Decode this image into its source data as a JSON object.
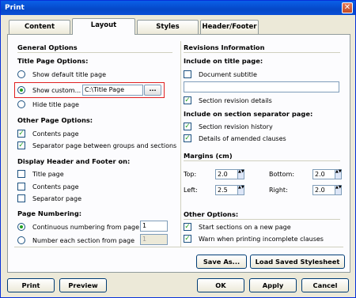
{
  "window": {
    "title": "Print",
    "close_glyph": "✕"
  },
  "tabs": [
    {
      "label": "Content",
      "active": false
    },
    {
      "label": "Layout",
      "active": true
    },
    {
      "label": "Styles",
      "active": false
    },
    {
      "label": "Header/Footer",
      "active": false
    }
  ],
  "general": {
    "heading": "General Options",
    "title_page_heading": "Title Page Options:",
    "show_default": "Show default title page",
    "show_custom": "Show custom...",
    "custom_path": "C:\\Title Page",
    "browse_label": "...",
    "hide_title": "Hide title page",
    "other_heading": "Other Page Options:",
    "contents_page": "Contents page",
    "separator_page": "Separator page between groups and sections",
    "display_heading": "Display Header and Footer on:",
    "hf_title_page": "Title page",
    "hf_contents_page": "Contents page",
    "hf_separator_page": "Separator page",
    "numbering_heading": "Page Numbering:",
    "continuous": "Continuous numbering from page",
    "continuous_value": "1",
    "each_section": "Number each section from page",
    "each_section_value": "1"
  },
  "revisions": {
    "heading": "Revisions Information",
    "include_title": "Include on title page:",
    "doc_subtitle": "Document subtitle",
    "subtitle_value": "",
    "section_details": "Section revision details",
    "include_sep": "Include on section separator page:",
    "section_history": "Section revision history",
    "amended": "Details of amended clauses"
  },
  "margins": {
    "heading": "Margins (cm)",
    "top_label": "Top:",
    "top": "2.0",
    "bottom_label": "Bottom:",
    "bottom": "2.0",
    "left_label": "Left:",
    "left": "2.5",
    "right_label": "Right:",
    "right": "2.0"
  },
  "other": {
    "heading": "Other Options:",
    "new_page": "Start sections on a new page",
    "warn": "Warn when printing incomplete clauses"
  },
  "buttons": {
    "save_as": "Save As...",
    "load": "Load Saved Stylesheet",
    "print": "Print",
    "preview": "Preview",
    "ok": "OK",
    "apply": "Apply",
    "cancel": "Cancel"
  },
  "check_glyph": "✓",
  "spin_glyph": "▲▼"
}
